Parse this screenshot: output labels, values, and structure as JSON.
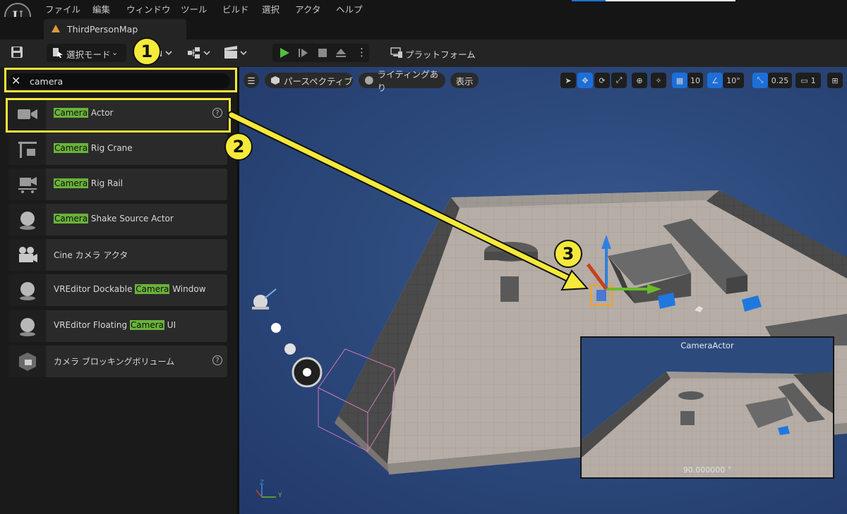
{
  "menu": {
    "logo": "U",
    "items": [
      "ファイル",
      "編集",
      "ウィンドウ",
      "ツール",
      "ビルド",
      "選択",
      "アクタ",
      "ヘルプ"
    ]
  },
  "tab": {
    "label": "ThirdPersonMap"
  },
  "toolbar": {
    "mode_label": "選択モード",
    "platform_label": "プラットフォーム"
  },
  "search": {
    "value": "camera"
  },
  "place_actors": [
    {
      "pre": "",
      "match": "Camera",
      "post": " Actor",
      "icon": "video-camera-icon",
      "help": true
    },
    {
      "pre": "",
      "match": "Camera",
      "post": " Rig Crane",
      "icon": "crane-icon",
      "help": false
    },
    {
      "pre": "",
      "match": "Camera",
      "post": " Rig Rail",
      "icon": "rail-icon",
      "help": false
    },
    {
      "pre": "",
      "match": "Camera",
      "post": " Shake Source Actor",
      "icon": "sphere-icon",
      "help": false
    },
    {
      "pre": "Cine カメラ アクタ",
      "match": "",
      "post": "",
      "icon": "film-camera-icon",
      "help": false
    },
    {
      "pre": "VREditor Dockable ",
      "match": "Camera",
      "post": " Window",
      "icon": "sphere-icon",
      "help": false
    },
    {
      "pre": "VREditor Floating ",
      "match": "Camera",
      "post": " UI",
      "icon": "sphere-icon",
      "help": false
    },
    {
      "pre": "カメラ ブロッキングボリューム",
      "match": "",
      "post": "",
      "icon": "blocking-volume-icon",
      "help": true
    }
  ],
  "viewport": {
    "perspective_label": "パースペクティブ",
    "lighting_label": "ライティングあり",
    "show_label": "表示",
    "grid_snap": "10",
    "rotation_snap": "10°",
    "scale_snap": "0.25",
    "camera_speed": "1",
    "axis_z": "Z",
    "axis_y": "Y"
  },
  "annotations": {
    "step1": "1",
    "step2": "2",
    "step3": "3"
  },
  "preview": {
    "title": "CameraActor",
    "fov": "90.000000 °"
  },
  "colors": {
    "highlight": "#6ab23a",
    "annotation": "#f5e93a",
    "accent": "#1c6fd8",
    "floor": "#b5ada6"
  }
}
